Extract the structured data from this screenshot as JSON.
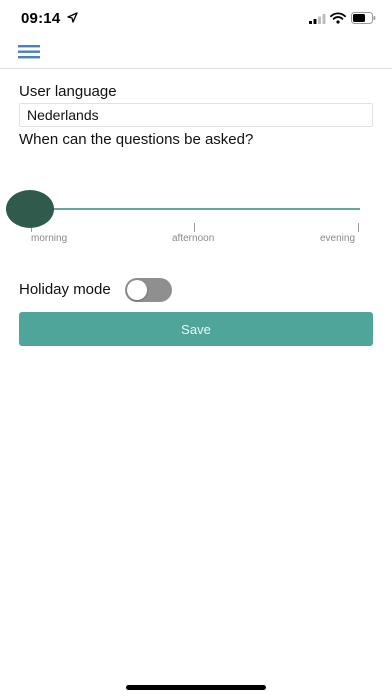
{
  "status_bar": {
    "time": "09:14",
    "icons": [
      "location-arrow-icon",
      "cellular-signal-icon",
      "wifi-icon",
      "battery-icon"
    ]
  },
  "header": {
    "menu_icon": "hamburger-menu-icon",
    "accent_color": "#4a7fc1"
  },
  "form": {
    "language_label": "User language",
    "language_value": "Nederlands",
    "questions_label": "When can the questions be asked?",
    "time_slider": {
      "options": [
        "morning",
        "afternoon",
        "evening"
      ],
      "selected": "morning",
      "track_color": "#64a79c",
      "thumb_color": "#2f5a4c"
    },
    "holiday_label": "Holiday mode",
    "holiday_enabled": false,
    "save_label": "Save",
    "save_color": "#4fa59a"
  }
}
